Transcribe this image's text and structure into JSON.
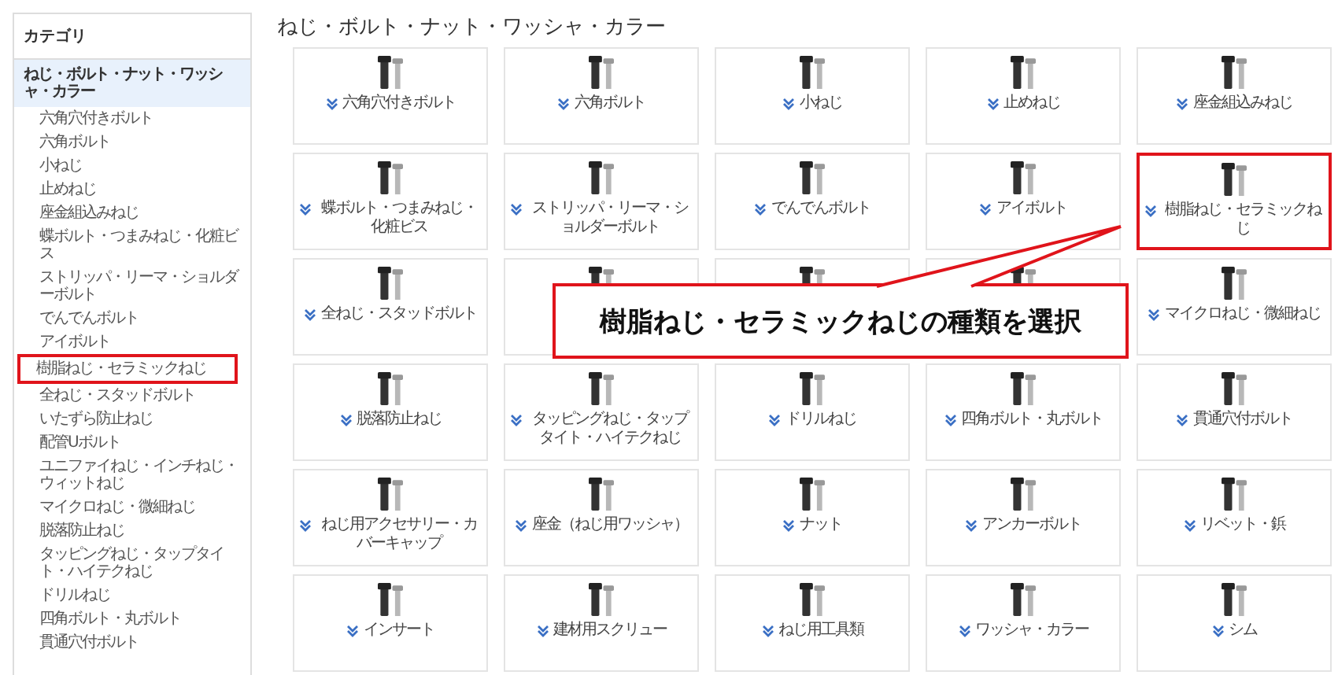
{
  "sidebar": {
    "title": "カテゴリ",
    "items": [
      {
        "label": "ねじ・ボルト・ナット・ワッシャ・カラー",
        "selected": true,
        "highlighted": false
      },
      {
        "label": "六角穴付きボルト",
        "selected": false,
        "highlighted": false
      },
      {
        "label": "六角ボルト",
        "selected": false,
        "highlighted": false
      },
      {
        "label": "小ねじ",
        "selected": false,
        "highlighted": false
      },
      {
        "label": "止めねじ",
        "selected": false,
        "highlighted": false
      },
      {
        "label": "座金組込みねじ",
        "selected": false,
        "highlighted": false
      },
      {
        "label": "蝶ボルト・つまみねじ・化粧ビス",
        "selected": false,
        "highlighted": false
      },
      {
        "label": "ストリッパ・リーマ・ショルダーボルト",
        "selected": false,
        "highlighted": false
      },
      {
        "label": "でんでんボルト",
        "selected": false,
        "highlighted": false
      },
      {
        "label": "アイボルト",
        "selected": false,
        "highlighted": false
      },
      {
        "label": "樹脂ねじ・セラミックねじ",
        "selected": false,
        "highlighted": true
      },
      {
        "label": "全ねじ・スタッドボルト",
        "selected": false,
        "highlighted": false
      },
      {
        "label": "いたずら防止ねじ",
        "selected": false,
        "highlighted": false
      },
      {
        "label": "配管Uボルト",
        "selected": false,
        "highlighted": false
      },
      {
        "label": "ユニファイねじ・インチねじ・ウィットねじ",
        "selected": false,
        "highlighted": false
      },
      {
        "label": "マイクロねじ・微細ねじ",
        "selected": false,
        "highlighted": false
      },
      {
        "label": "脱落防止ねじ",
        "selected": false,
        "highlighted": false
      },
      {
        "label": "タッピングねじ・タップタイト・ハイテクねじ",
        "selected": false,
        "highlighted": false
      },
      {
        "label": "ドリルねじ",
        "selected": false,
        "highlighted": false
      },
      {
        "label": "四角ボルト・丸ボルト",
        "selected": false,
        "highlighted": false
      },
      {
        "label": "貫通穴付ボルト",
        "selected": false,
        "highlighted": false
      }
    ]
  },
  "main": {
    "title": "ねじ・ボルト・ナット・ワッシャ・カラー",
    "cards": [
      {
        "label": "六角穴付きボルト",
        "highlighted": false
      },
      {
        "label": "六角ボルト",
        "highlighted": false
      },
      {
        "label": "小ねじ",
        "highlighted": false
      },
      {
        "label": "止めねじ",
        "highlighted": false
      },
      {
        "label": "座金組込みねじ",
        "highlighted": false
      },
      {
        "label": "蝶ボルト・つまみねじ・化粧ビス",
        "highlighted": false
      },
      {
        "label": "ストリッパ・リーマ・ショルダーボルト",
        "highlighted": false
      },
      {
        "label": "でんでんボルト",
        "highlighted": false
      },
      {
        "label": "アイボルト",
        "highlighted": false
      },
      {
        "label": "樹脂ねじ・セラミックねじ",
        "highlighted": true
      },
      {
        "label": "全ねじ・スタッドボルト",
        "highlighted": false
      },
      {
        "highlighted": false
      },
      {
        "highlighted": false
      },
      {
        "highlighted": false
      },
      {
        "label": "マイクロねじ・微細ねじ",
        "highlighted": false
      },
      {
        "label": "脱落防止ねじ",
        "highlighted": false
      },
      {
        "label": "タッピングねじ・タップタイト・ハイテクねじ",
        "highlighted": false
      },
      {
        "label": "ドリルねじ",
        "highlighted": false
      },
      {
        "label": "四角ボルト・丸ボルト",
        "highlighted": false
      },
      {
        "label": "貫通穴付ボルト",
        "highlighted": false
      },
      {
        "label": "ねじ用アクセサリー・カバーキャップ",
        "highlighted": false
      },
      {
        "label": "座金（ねじ用ワッシャ）",
        "highlighted": false
      },
      {
        "label": "ナット",
        "highlighted": false
      },
      {
        "label": "アンカーボルト",
        "highlighted": false
      },
      {
        "label": "リベット・鋲",
        "highlighted": false
      },
      {
        "label": "インサート",
        "highlighted": false
      },
      {
        "label": "建材用スクリュー",
        "highlighted": false
      },
      {
        "label": "ねじ用工具類",
        "highlighted": false
      },
      {
        "label": "ワッシャ・カラー",
        "highlighted": false
      },
      {
        "label": "シム",
        "highlighted": false
      }
    ]
  },
  "callout": {
    "text": "樹脂ねじ・セラミックねじの種類を選択"
  }
}
